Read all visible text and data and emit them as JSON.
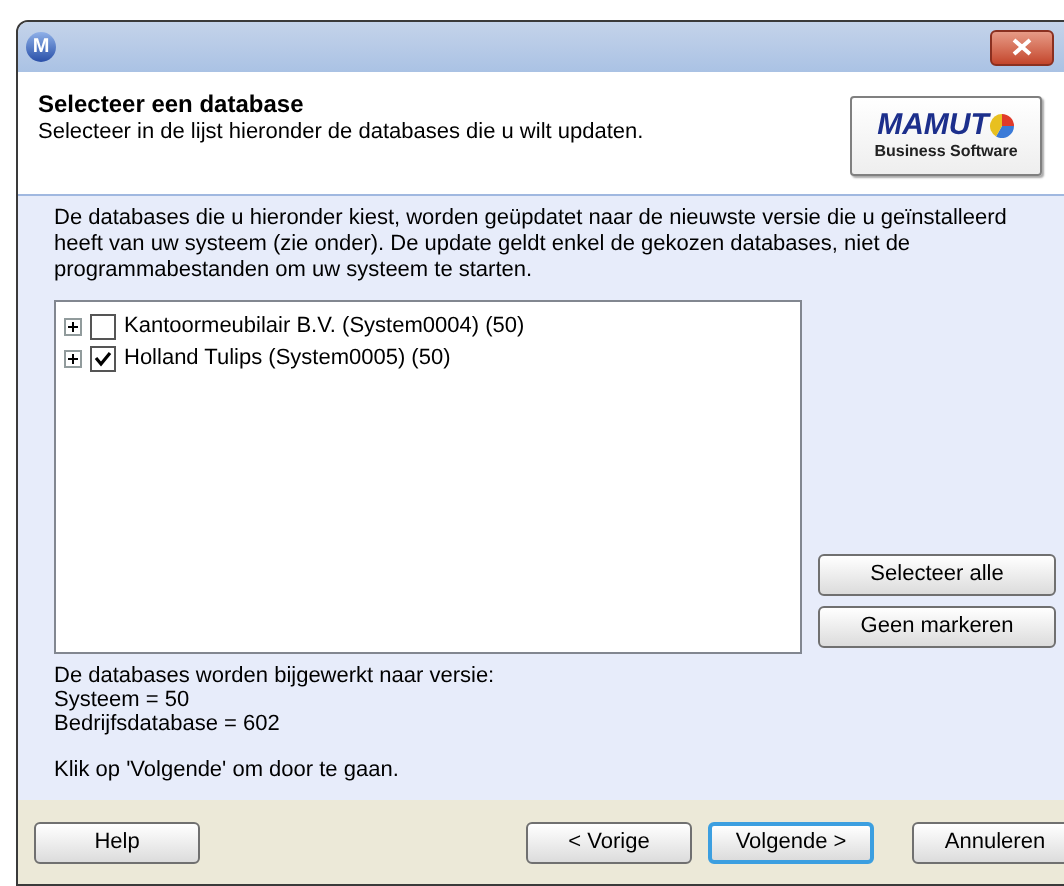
{
  "window": {
    "title_icon": "M"
  },
  "header": {
    "title": "Selecteer een database",
    "subtitle": "Selecteer in de lijst hieronder de databases die u wilt updaten.",
    "logo": {
      "name": "MAMUT",
      "tagline": "Business Software"
    }
  },
  "intro": "De databases die u hieronder kiest, worden geüpdatet naar de nieuwste versie die u geïnstalleerd heeft van uw systeem (zie onder). De update geldt enkel de gekozen databases, niet de programmabestanden om uw systeem te starten.",
  "tree": [
    {
      "label": "Kantoormeubilair B.V. (System0004) (50)",
      "expanded": false,
      "checked": false
    },
    {
      "label": "Holland Tulips (System0005) (50)",
      "expanded": false,
      "checked": true
    }
  ],
  "side_buttons": [
    "Selecteer alle",
    "Geen markeren"
  ],
  "version_info": [
    "De databases worden bijgewerkt naar versie:",
    "Systeem = 50",
    "Bedrijfsdatabase = 602"
  ],
  "hint": "Klik op 'Volgende' om door te gaan.",
  "footer_buttons": [
    {
      "label": "Help",
      "default": false
    },
    {
      "label": "< Vorige",
      "default": false
    },
    {
      "label": "Volgende >",
      "default": true
    },
    {
      "label": "Annuleren",
      "default": false
    }
  ]
}
